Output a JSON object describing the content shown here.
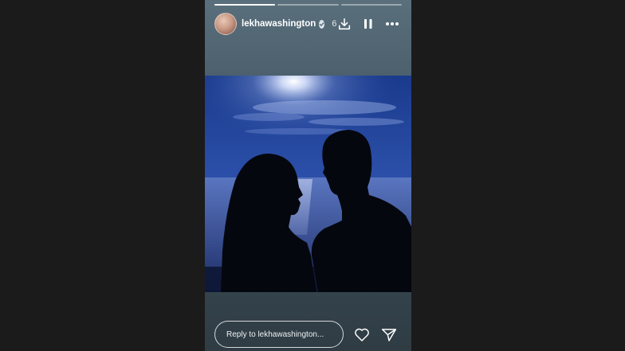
{
  "story": {
    "username": "lekhawashington",
    "time_ago": "6",
    "progress": [
      1.0,
      0.0,
      0.0
    ]
  },
  "icons": {
    "verified": "verified-badge-icon",
    "download": "download-icon",
    "pause": "pause-icon",
    "more": "more-options-icon",
    "like": "heart-icon",
    "share": "send-icon"
  },
  "reply": {
    "placeholder": "Reply to lekhawashington..."
  },
  "colors": {
    "page_background": "#1b1b1b",
    "story_background": "#4d616e",
    "text": "#ffffff"
  }
}
